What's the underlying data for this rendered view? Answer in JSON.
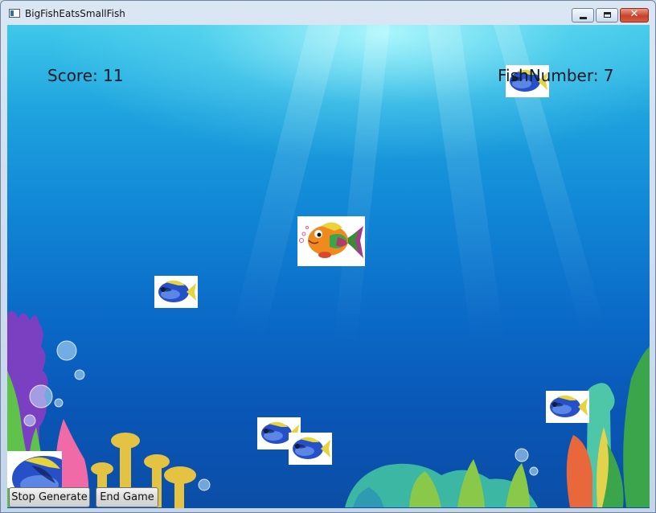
{
  "window": {
    "title": "BigFishEatsSmallFish",
    "close_glyph": "✕"
  },
  "hud": {
    "score": "Score: 11",
    "fish_number": "FishNumber: 7"
  },
  "buttons": {
    "stop_generate": "Stop Generate",
    "end_game": "End Game"
  },
  "colors": {
    "water_top": "#3fc8ea",
    "water_bottom": "#0b4ea6",
    "enemy_fish": "#2255cc",
    "player_fish": "#f08a1c"
  }
}
